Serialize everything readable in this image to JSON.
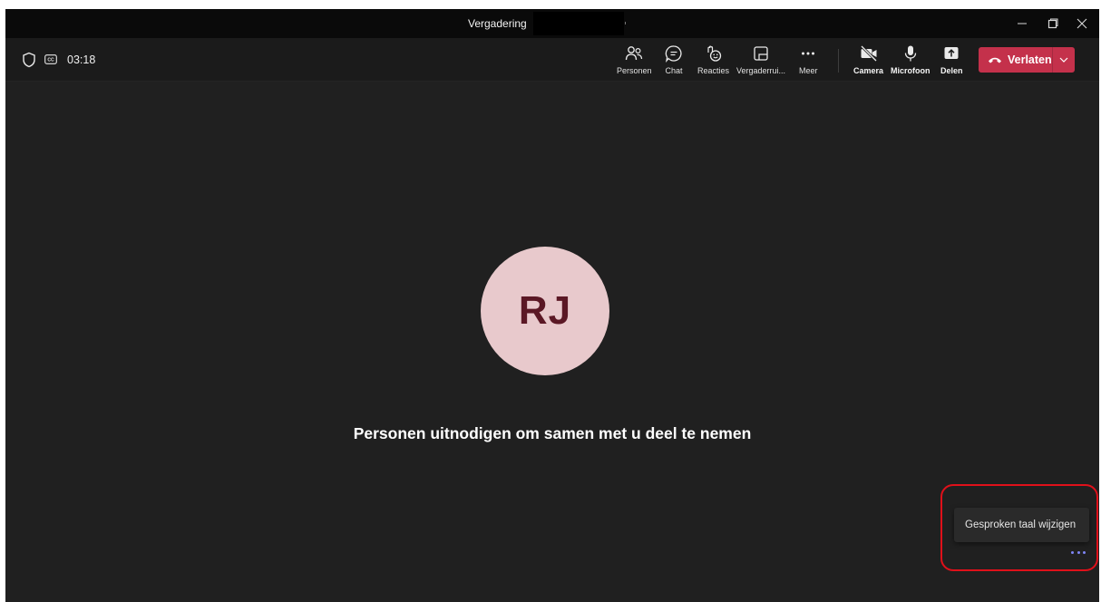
{
  "window": {
    "title": "Vergadering",
    "controls": [
      "minimize-icon",
      "maximize-icon",
      "close-icon"
    ]
  },
  "toolbar": {
    "timer": "03:18",
    "left_icons": [
      "shield-icon",
      "closed-captions-icon"
    ],
    "buttons": {
      "people": "Personen",
      "chat": "Chat",
      "reactions": "Reacties",
      "rooms": "Vergaderrui...",
      "more": "Meer",
      "camera": "Camera",
      "microphone": "Microfoon",
      "share": "Delen"
    },
    "leave": "Verlaten"
  },
  "stage": {
    "avatar_initials": "RJ",
    "invite_text": "Personen uitnodigen om samen met u deel te nemen"
  },
  "language_popup": {
    "label": "Gesproken taal wijzigen"
  },
  "colors": {
    "leave": "#c4314b",
    "avatar": "#e8c9cc",
    "avatar_text": "#5b1825",
    "accent": "#7f85f5",
    "highlight": "#e0101a"
  }
}
